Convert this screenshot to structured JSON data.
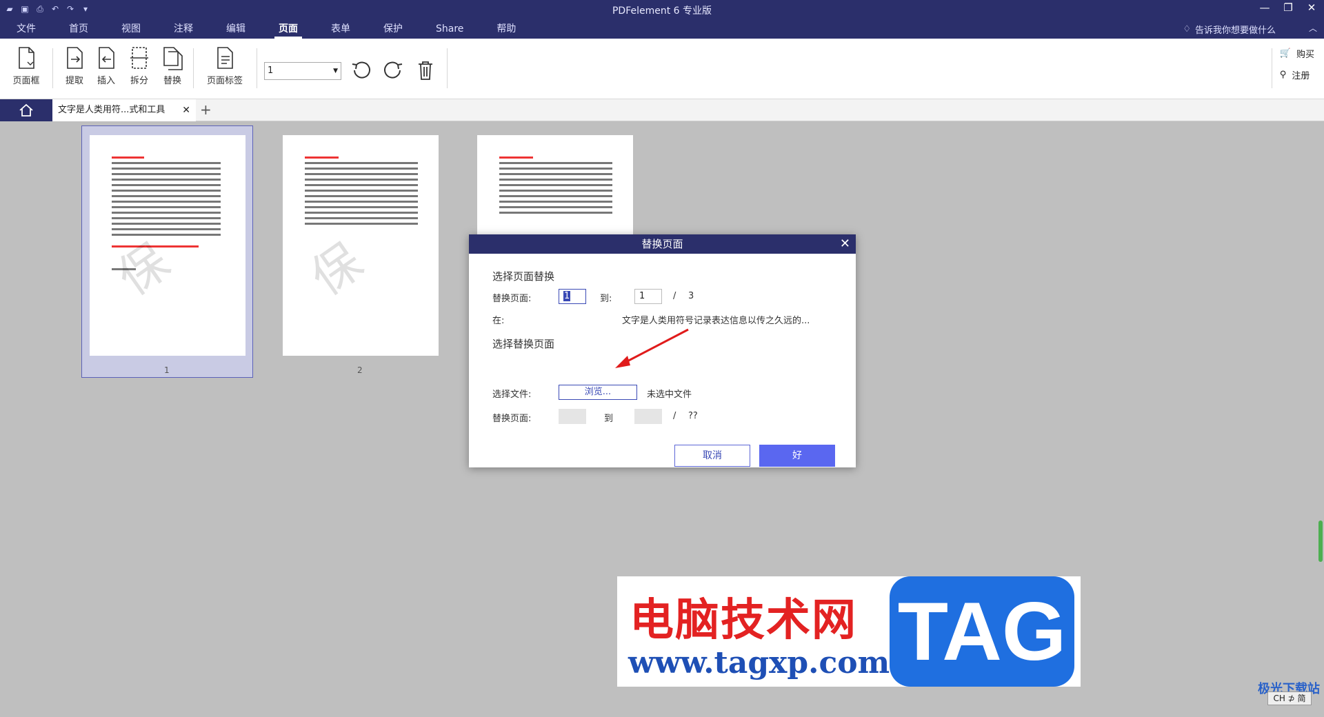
{
  "window": {
    "title": "PDFelement  6 专业版",
    "tell_me": "告诉我你想要做什么"
  },
  "menu": [
    "文件",
    "首页",
    "视图",
    "注释",
    "编辑",
    "页面",
    "表单",
    "保护",
    "Share",
    "帮助"
  ],
  "menu_active": "页面",
  "ribbon": {
    "page_box": "页面框",
    "extract": "提取",
    "insert": "插入",
    "split": "拆分",
    "replace": "替换",
    "page_label": "页面标签",
    "page_select_value": "1",
    "buy": "购买",
    "register": "注册"
  },
  "tabs": {
    "doc_tab": "文字是人类用符...式和工具"
  },
  "thumbnails": [
    {
      "number": "1",
      "selected": true
    },
    {
      "number": "2",
      "selected": false
    },
    {
      "number": "",
      "selected": false
    }
  ],
  "dialog": {
    "title": "替换页面",
    "section1": "选择页面替换",
    "replace_pages_label": "替换页面:",
    "from_value": "1",
    "to_label": "到:",
    "to_value": "1",
    "slash": "/",
    "total": "3",
    "in_label": "在:",
    "in_value": "文字是人类用符号记录表达信息以传之久远的...",
    "section2": "选择替换页面",
    "choose_file_label": "选择文件:",
    "browse_button": "浏览...",
    "no_file": "未选中文件",
    "replace_pages_label2": "替换页面:",
    "to_label2": "到",
    "total2": "??",
    "cancel": "取消",
    "ok": "好"
  },
  "banner": {
    "cn": "电脑技术网",
    "url": "www.tagxp.com",
    "tag": "TAG"
  },
  "corner": {
    "logo": "极光下载站",
    "ime": "CH ⊅ 简"
  },
  "colors": {
    "titlebar": "#2b2f6b",
    "accent": "#5a67f0"
  }
}
